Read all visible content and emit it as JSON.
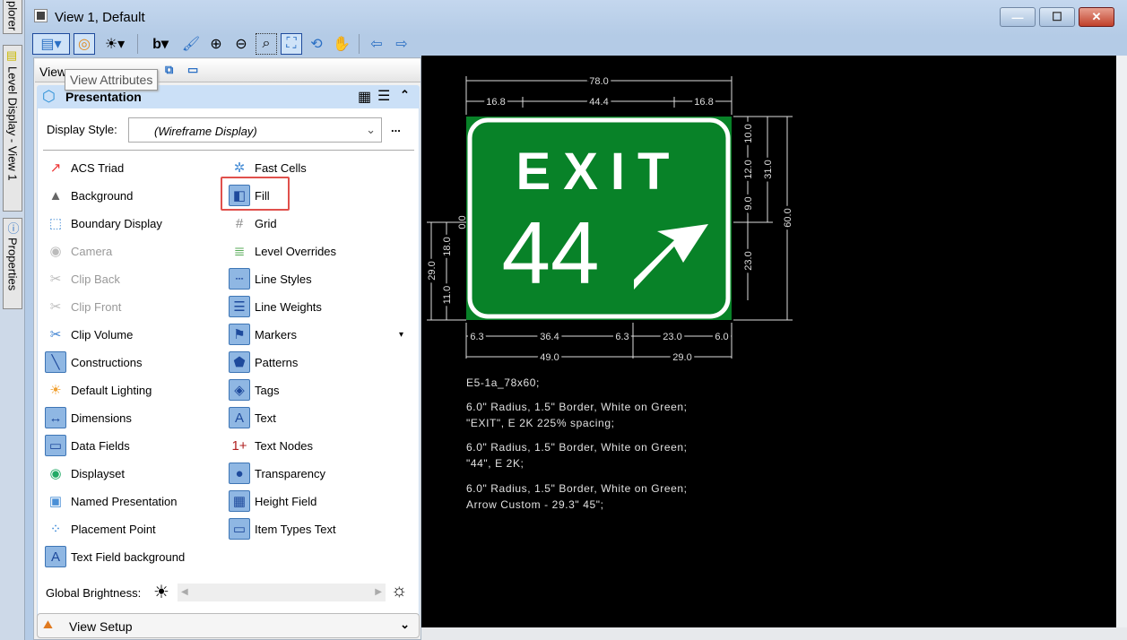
{
  "side_tabs": [
    "plorer",
    "Level Display - View 1",
    "Properties"
  ],
  "window": {
    "title": "View 1, Default",
    "min": "—",
    "max": "☐",
    "close": "✕"
  },
  "toolbar": {
    "tooltip": "View Attributes",
    "subheader": "View"
  },
  "presentation": {
    "title": "Presentation",
    "display_style_label": "Display Style:",
    "display_style_value": "(Wireframe Display)",
    "more": "...",
    "left_items": [
      {
        "label": "ACS Triad",
        "icon": "acs-triad-icon",
        "g": "↗",
        "c": "#e33",
        "en": true
      },
      {
        "label": "Background",
        "icon": "background-icon",
        "g": "▲",
        "c": "#666",
        "en": true
      },
      {
        "label": "Boundary Display",
        "icon": "boundary-display-icon",
        "g": "⬚",
        "c": "#4a8fd6",
        "en": true
      },
      {
        "label": "Camera",
        "icon": "camera-icon",
        "g": "◉",
        "c": "#bbb",
        "en": false
      },
      {
        "label": "Clip Back",
        "icon": "clip-back-icon",
        "g": "✂",
        "c": "#bbb",
        "en": false
      },
      {
        "label": "Clip Front",
        "icon": "clip-front-icon",
        "g": "✂",
        "c": "#bbb",
        "en": false
      },
      {
        "label": "Clip Volume",
        "icon": "clip-volume-icon",
        "g": "✂",
        "c": "#3a7fd0",
        "en": true
      },
      {
        "label": "Constructions",
        "icon": "constructions-icon",
        "g": "╲",
        "c": "#8fb7e3",
        "en": true,
        "sel": true
      },
      {
        "label": "Default Lighting",
        "icon": "default-lighting-icon",
        "g": "☀",
        "c": "#f0a030",
        "en": true
      },
      {
        "label": "Dimensions",
        "icon": "dimensions-icon",
        "g": "↔",
        "c": "#8fb7e3",
        "en": true,
        "sel": true
      },
      {
        "label": "Data Fields",
        "icon": "data-fields-icon",
        "g": "▭",
        "c": "#8fb7e3",
        "en": true,
        "sel": true
      },
      {
        "label": "Displayset",
        "icon": "displayset-icon",
        "g": "◉",
        "c": "#2a6",
        "en": true
      },
      {
        "label": "Named Presentation",
        "icon": "named-presentation-icon",
        "g": "▣",
        "c": "#4a8fd6",
        "en": true
      },
      {
        "label": "Placement Point",
        "icon": "placement-point-icon",
        "g": "⁘",
        "c": "#2a7fd4",
        "en": true
      },
      {
        "label": "Text Field background",
        "icon": "text-field-background-icon",
        "g": "A",
        "c": "#8fb7e3",
        "en": true,
        "sel": true
      }
    ],
    "right_items": [
      {
        "label": "Fast Cells",
        "icon": "fast-cells-icon",
        "g": "✲",
        "c": "#4a8fd6"
      },
      {
        "label": "Fill",
        "icon": "fill-icon",
        "g": "◧",
        "c": "#8fb7e3",
        "sel": true
      },
      {
        "label": "Grid",
        "icon": "grid-icon",
        "g": "#",
        "c": "#888"
      },
      {
        "label": "Level Overrides",
        "icon": "level-overrides-icon",
        "g": "≣",
        "c": "#5a5"
      },
      {
        "label": "Line Styles",
        "icon": "line-styles-icon",
        "g": "┄",
        "c": "#8fb7e3",
        "sel": true
      },
      {
        "label": "Line Weights",
        "icon": "line-weights-icon",
        "g": "☰",
        "c": "#8fb7e3",
        "sel": true
      },
      {
        "label": "Markers",
        "icon": "markers-icon",
        "g": "⚑",
        "c": "#8fb7e3",
        "sel": true,
        "dd": "▾"
      },
      {
        "label": "Patterns",
        "icon": "patterns-icon",
        "g": "⬟",
        "c": "#8fb7e3",
        "sel": true
      },
      {
        "label": "Tags",
        "icon": "tags-icon",
        "g": "◈",
        "c": "#8fb7e3",
        "sel": true
      },
      {
        "label": "Text",
        "icon": "text-icon",
        "g": "A",
        "c": "#8fb7e3",
        "sel": true
      },
      {
        "label": "Text Nodes",
        "icon": "text-nodes-icon",
        "g": "1+",
        "c": "#b02020"
      },
      {
        "label": "Transparency",
        "icon": "transparency-icon",
        "g": "●",
        "c": "#8fb7e3",
        "sel": true
      },
      {
        "label": "Height Field",
        "icon": "height-field-icon",
        "g": "▦",
        "c": "#8fb7e3",
        "sel": true
      },
      {
        "label": "Item Types Text",
        "icon": "item-types-text-icon",
        "g": "▭",
        "c": "#8fb7e3",
        "sel": true
      }
    ],
    "brightness_label": "Global Brightness:"
  },
  "view_setup": "View Setup",
  "sign": {
    "line1": "EXIT",
    "line2": "44",
    "green": "#088228",
    "dims": {
      "top_total": "78.0",
      "top_l": "16.8",
      "top_m": "44.4",
      "top_r": "16.8",
      "r1": "10.0",
      "r2": "12.0",
      "r3": "9.0",
      "r4": "23.0",
      "r_mid": "31.0",
      "r_total": "60.0",
      "l_zero": "0.0",
      "l1": "18.0",
      "l2": "11.0",
      "l_total": "29.0",
      "b1": "6.3",
      "b2": "36.4",
      "b3": "6.3",
      "b4": "23.0",
      "b5": "6.0",
      "b_l": "49.0",
      "b_r": "29.0"
    }
  },
  "notes": [
    "E5-1a_78x60;",
    "6.0\" Radius, 1.5\" Border, White on Green;",
    "\"EXIT\",  E 2K 225% spacing;",
    "6.0\" Radius, 1.5\" Border, White on Green;",
    "\"44\",  E 2K;",
    "6.0\" Radius, 1.5\" Border, White on Green;",
    "Arrow Custom - 29.3\" 45\";"
  ]
}
